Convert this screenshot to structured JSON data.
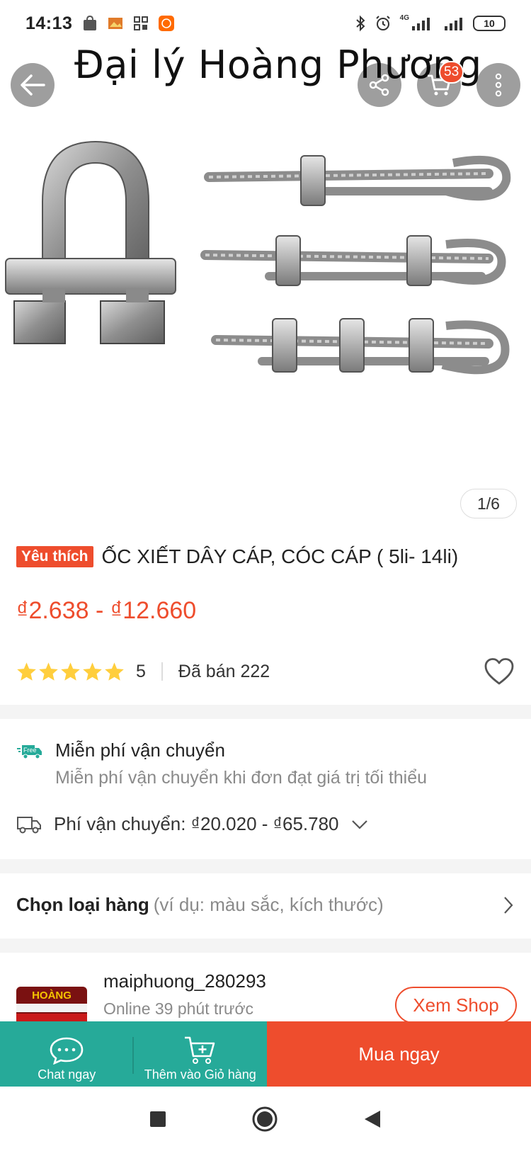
{
  "status_bar": {
    "time": "14:13",
    "net_label": "4G",
    "battery": "10"
  },
  "hero": {
    "shop_watermark": "Đại lý Hoàng Phương",
    "cart_count": "53",
    "image_counter": "1/6"
  },
  "product": {
    "badge": "Yêu thích",
    "title": "ỐC XIẾT DÂY CÁP, CÓC CÁP ( 5li- 14li)",
    "price": "₫2.638 - ₫12.660",
    "rating": "5",
    "sold": "Đã bán 222",
    "rating_stars": 5
  },
  "shipping": {
    "free_badge": "Free",
    "free_title": "Miễn phí vận chuyển",
    "free_subtitle": "Miễn phí vận chuyển khi đơn đạt giá trị tối thiểu",
    "fee_label": "Phí vận chuyển: ₫20.020 - ₫65.780"
  },
  "variant": {
    "label": "Chọn loại hàng",
    "hint": "(ví dụ: màu sắc, kích thước)"
  },
  "shop": {
    "avatar_text": "HOÀNG PHƯƠNG",
    "name": "maiphuong_280293",
    "online": "Online 39 phút trước",
    "view_button": "Xem Shop"
  },
  "bottom_bar": {
    "chat": "Chat ngay",
    "add_to_cart": "Thêm vào Giỏ hàng",
    "buy_now": "Mua ngay"
  },
  "colors": {
    "accent": "#ee4d2d",
    "teal": "#26aa99",
    "star": "#ffce3d"
  }
}
